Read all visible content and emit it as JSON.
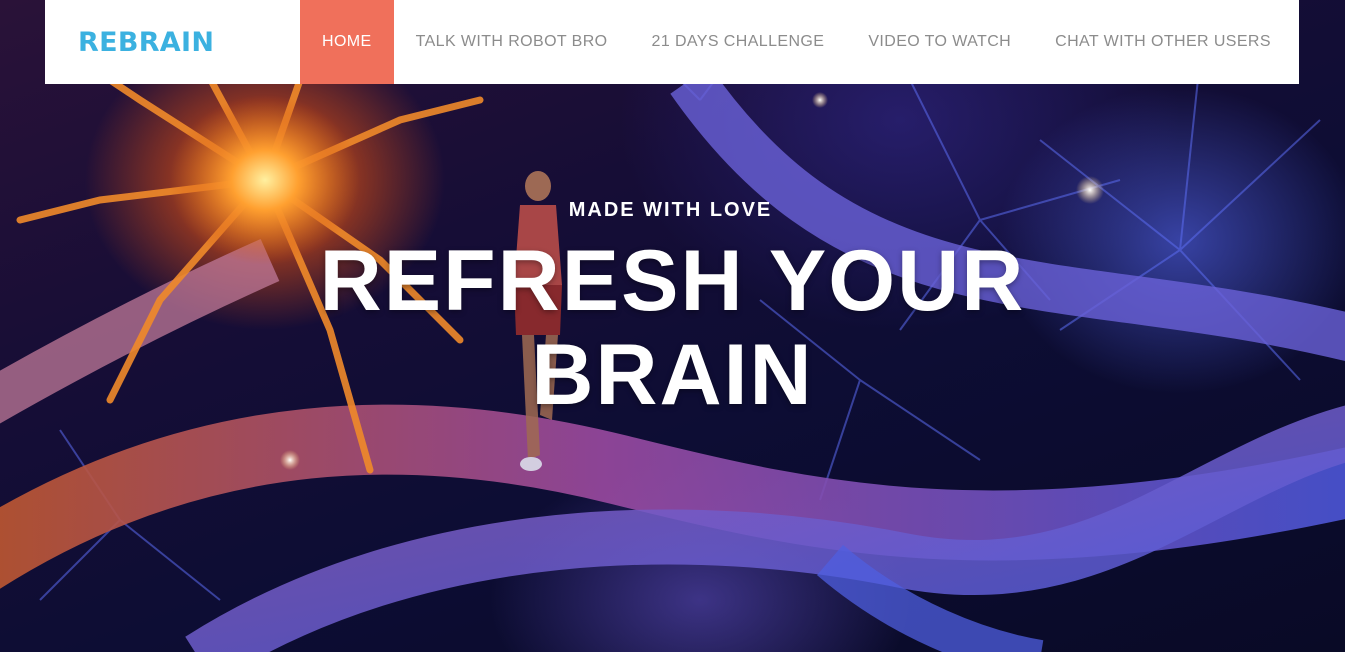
{
  "brand": {
    "name": "REBRAIN",
    "color": "#3bb1e0"
  },
  "nav": {
    "items": [
      {
        "label": "HOME",
        "active": true
      },
      {
        "label": "TALK WITH ROBOT BRO",
        "active": false
      },
      {
        "label": "21 DAYS CHALLENGE",
        "active": false
      },
      {
        "label": "VIDEO TO WATCH",
        "active": false
      },
      {
        "label": "CHAT WITH OTHER USERS",
        "active": false
      }
    ],
    "active_color": "#f0705b"
  },
  "hero": {
    "kicker": "MADE WITH LOVE",
    "headline_line1": "REFRESH YOUR",
    "headline_line2": "BRAIN",
    "background_image": "neurons-with-runner"
  }
}
